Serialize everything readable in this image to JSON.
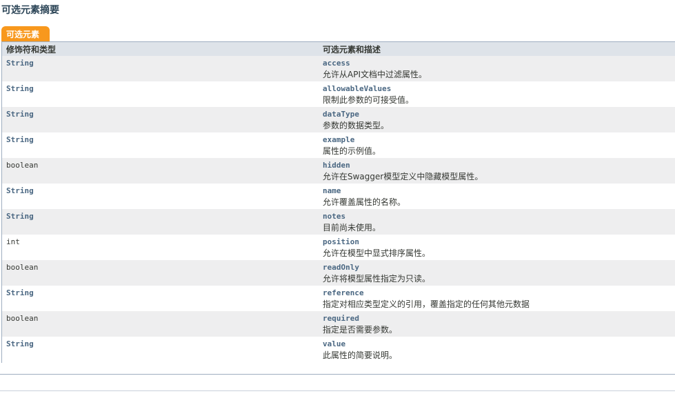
{
  "section": {
    "title": "可选元素摘要",
    "caption": "可选元素"
  },
  "table": {
    "headers": [
      "修饰符和类型",
      "可选元素和描述"
    ],
    "rows": [
      {
        "type": "String",
        "type_kind": "link",
        "name": "access",
        "desc": "允许从API文档中过滤属性。"
      },
      {
        "type": "String",
        "type_kind": "link",
        "name": "allowableValues",
        "desc": "限制此参数的可接受值。"
      },
      {
        "type": "String",
        "type_kind": "link",
        "name": "dataType",
        "desc": "参数的数据类型。"
      },
      {
        "type": "String",
        "type_kind": "link",
        "name": "example",
        "desc": "属性的示例值。"
      },
      {
        "type": "boolean",
        "type_kind": "primitive",
        "name": "hidden",
        "desc": "允许在Swagger模型定义中隐藏模型属性。"
      },
      {
        "type": "String",
        "type_kind": "link",
        "name": "name",
        "desc": "允许覆盖属性的名称。"
      },
      {
        "type": "String",
        "type_kind": "link",
        "name": "notes",
        "desc": "目前尚未使用。"
      },
      {
        "type": "int",
        "type_kind": "primitive",
        "name": "position",
        "desc": "允许在模型中显式排序属性。"
      },
      {
        "type": "boolean",
        "type_kind": "primitive",
        "name": "readOnly",
        "desc": "允许将模型属性指定为只读。"
      },
      {
        "type": "String",
        "type_kind": "link",
        "name": "reference",
        "desc": "指定对相应类型定义的引用，覆盖指定的任何其他元数据"
      },
      {
        "type": "boolean",
        "type_kind": "primitive",
        "name": "required",
        "desc": "指定是否需要参数。"
      },
      {
        "type": "String",
        "type_kind": "link",
        "name": "value",
        "desc": "此属性的简要说明。"
      }
    ]
  },
  "colors": {
    "caption_bg": "#f8981d",
    "header_bg": "#dee3e9",
    "alt_row_bg": "#eeeeef",
    "link": "#4a6782"
  }
}
